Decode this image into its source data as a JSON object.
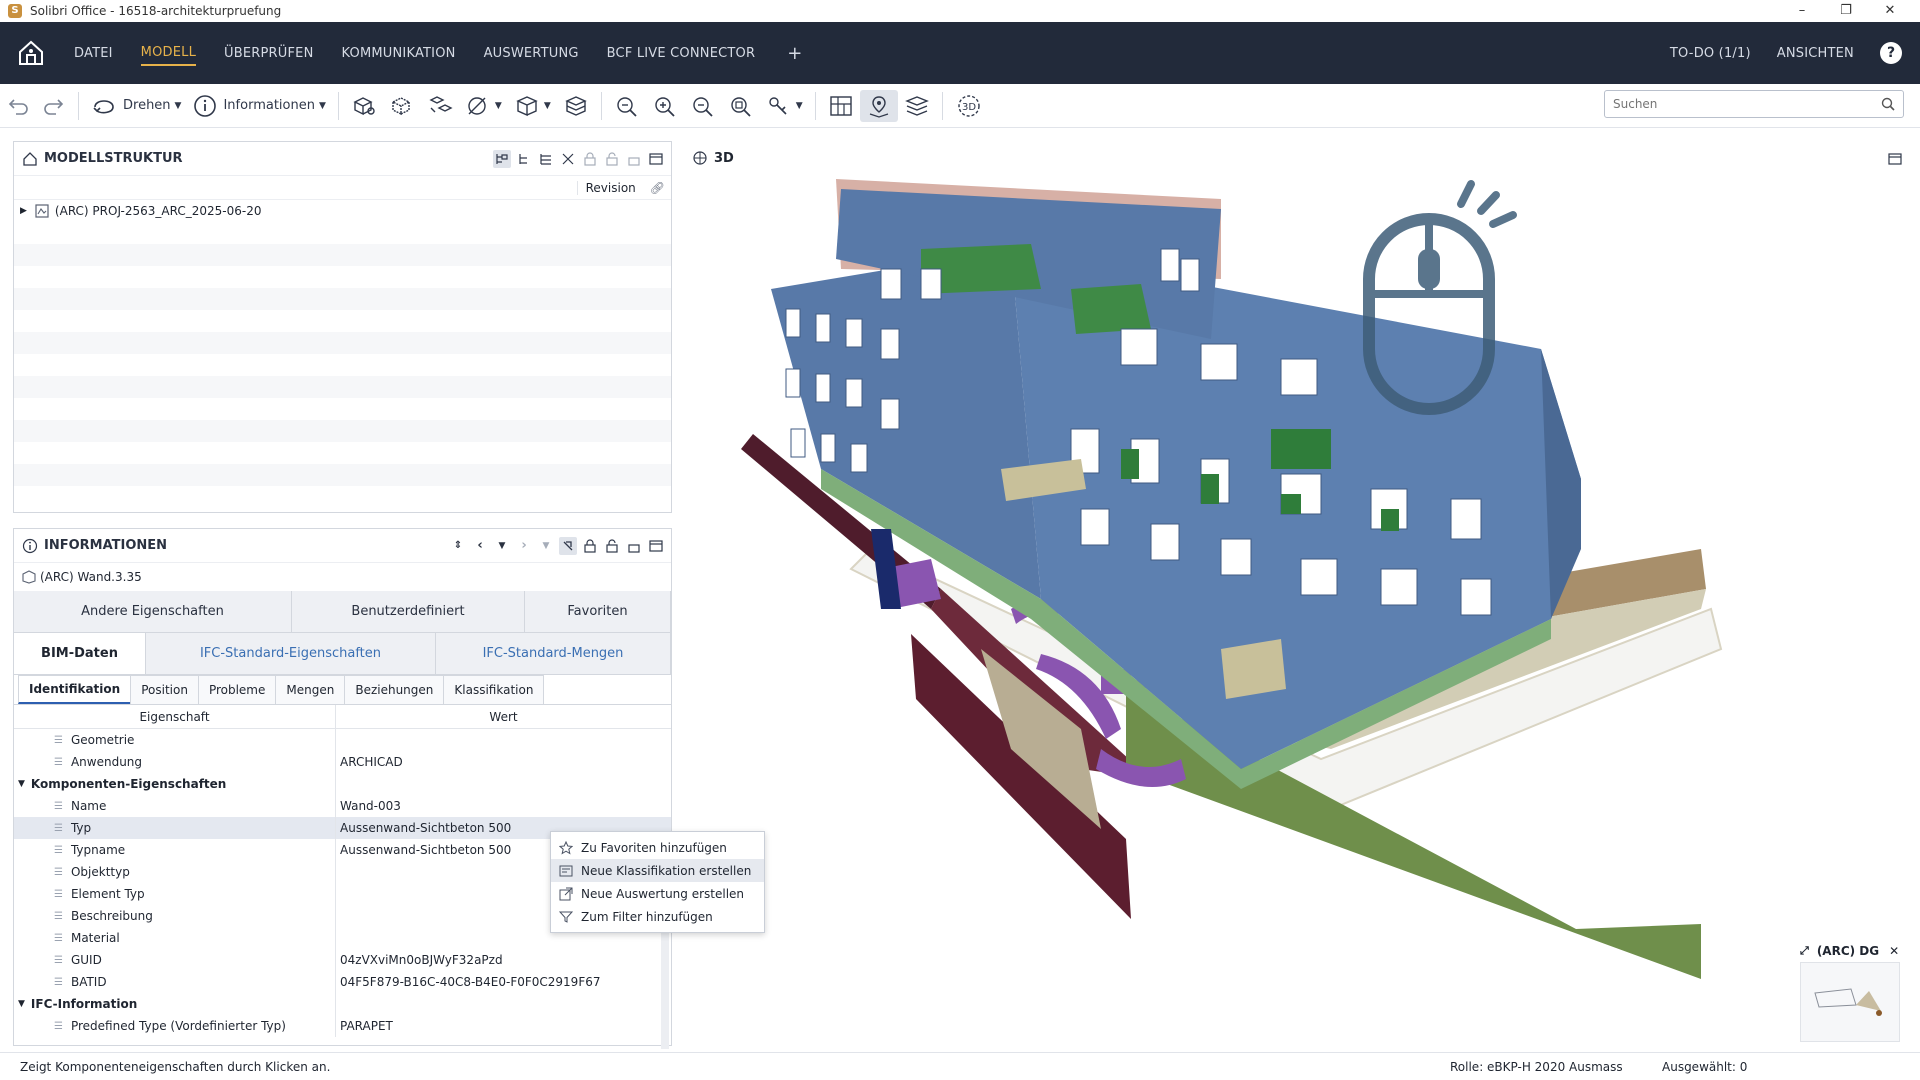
{
  "window": {
    "title": "Solibri Office - 16518-architekturpruefung"
  },
  "menu": {
    "items": [
      "DATEI",
      "MODELL",
      "ÜBERPRÜFEN",
      "KOMMUNIKATION",
      "AUSWERTUNG",
      "BCF LIVE CONNECTOR"
    ],
    "active": "MODELL",
    "plus": "+",
    "todo": "TO-DO (1/1)",
    "views": "ANSICHTEN",
    "help": "?"
  },
  "toolbar": {
    "rotate_label": "Drehen",
    "info_label": "Informationen",
    "search_placeholder": "Suchen"
  },
  "model_structure": {
    "title": "MODELLSTRUKTUR",
    "revision_label": "Revision",
    "root_item": "(ARC) PROJ-2563_ARC_2025-06-20"
  },
  "information": {
    "title": "INFORMATIONEN",
    "selected": "(ARC) Wand.3.35",
    "top_tabs": [
      "Andere Eigenschaften",
      "Benutzerdefiniert",
      "Favoriten"
    ],
    "mid_tabs": [
      "BIM-Daten",
      "IFC-Standard-Eigenschaften",
      "IFC-Standard-Mengen"
    ],
    "sub_tabs": [
      "Identifikation",
      "Position",
      "Probleme",
      "Mengen",
      "Beziehungen",
      "Klassifikation"
    ],
    "col_property": "Eigenschaft",
    "col_value": "Wert",
    "rows": [
      {
        "k": "Geometrie",
        "v": "",
        "type": "leaf"
      },
      {
        "k": "Anwendung",
        "v": "ARCHICAD",
        "type": "leaf"
      },
      {
        "k": "Komponenten-Eigenschaften",
        "v": "",
        "type": "group"
      },
      {
        "k": "Name",
        "v": "Wand-003",
        "type": "leaf"
      },
      {
        "k": "Typ",
        "v": "Aussenwand-Sichtbeton 500",
        "type": "leaf"
      },
      {
        "k": "Typname",
        "v": "Aussenwand-Sichtbeton 500",
        "type": "leaf"
      },
      {
        "k": "Objekttyp",
        "v": "",
        "type": "leaf"
      },
      {
        "k": "Element Typ",
        "v": "",
        "type": "leaf"
      },
      {
        "k": "Beschreibung",
        "v": "",
        "type": "leaf"
      },
      {
        "k": "Material",
        "v": "",
        "type": "leaf"
      },
      {
        "k": "GUID",
        "v": "04zVXviMn0oBJWyF32aPzd",
        "type": "leaf"
      },
      {
        "k": "BATID",
        "v": "04F5F879-B16C-40C8-B4E0-F0F0C2919F67",
        "type": "leaf"
      },
      {
        "k": "IFC-Information",
        "v": "",
        "type": "group"
      },
      {
        "k": "Predefined Type (Vordefinierter Typ)",
        "v": "PARAPET",
        "type": "leaf"
      }
    ]
  },
  "context_menu": [
    {
      "label": "Zu Favoriten hinzufügen",
      "icon": "star-icon"
    },
    {
      "label": "Neue Klassifikation erstellen",
      "icon": "classification-icon"
    },
    {
      "label": "Neue Auswertung erstellen",
      "icon": "report-icon"
    },
    {
      "label": "Zum Filter hinzufügen",
      "icon": "filter-icon"
    }
  ],
  "viewer": {
    "label": "3D",
    "minimap_label": "(ARC) DG"
  },
  "status": {
    "hint": "Zeigt Komponenteneigenschaften durch Klicken an.",
    "role": "Rolle: eBKP-H 2020 Ausmass",
    "selected": "Ausgewählt: 0"
  },
  "colors": {
    "menubar_bg": "#222a3a",
    "menu_active": "#e7b24a",
    "wall_blue": "#5879a8",
    "green_slab": "#6f8f4b",
    "purple_object": "#8a55b0",
    "dark_red_wall": "#5c1e2f"
  }
}
